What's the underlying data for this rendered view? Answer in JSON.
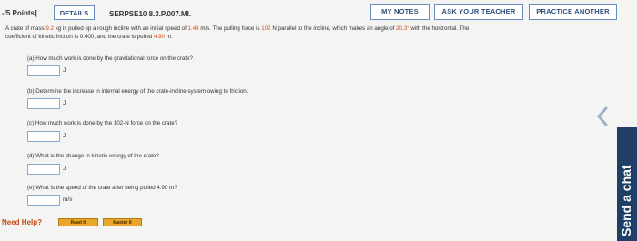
{
  "header": {
    "points": "-/5 Points]",
    "details_label": "DETAILS",
    "problem_id": "SERPSE10 8.3.P.007.MI.",
    "my_notes_label": "MY NOTES",
    "ask_teacher_label": "ASK YOUR TEACHER",
    "practice_label": "PRACTICE ANOTHER"
  },
  "problem": {
    "line1_a": "A crate of mass ",
    "mass": "9.2",
    "line1_b": " kg is pulled up a rough incline with an initial speed of ",
    "speed": "1.48",
    "line1_c": " m/s. The pulling force is ",
    "force": "102",
    "line1_d": " N parallel to the incline, which makes an angle of ",
    "angle": "20.3°",
    "line1_e": " with the horizontal. The",
    "line2_a": "coefficient of kinetic friction is 0.400, and the crate is pulled ",
    "distance": "4.90",
    "line2_b": " m."
  },
  "parts": [
    {
      "label": "(a) How much work is done by the gravitational force on the crate?",
      "unit": "J",
      "value": ""
    },
    {
      "label": "(b) Determine the increase in internal energy of the crate-incline system owing to friction.",
      "unit": "J",
      "value": ""
    },
    {
      "label": "(c) How much work is done by the 102-N force on the crate?",
      "unit": "J",
      "value": ""
    },
    {
      "label": "(d) What is the change in kinetic energy of the crate?",
      "unit": "J",
      "value": ""
    },
    {
      "label": "(e) What is the speed of the crate after being pulled 4.90 m?",
      "unit": "m/s",
      "value": ""
    }
  ],
  "help": {
    "label": "Need Help?",
    "read_it": "Read It",
    "master_it": "Master It"
  },
  "chat": {
    "label": "Send a chat"
  },
  "colors": {
    "highlight": "#d84a1b",
    "link_blue": "#2e4f7d",
    "chat_bg": "#1f3f66",
    "help_orange": "#e8a62a"
  },
  "icons": {
    "chevron": "chevron-left-icon"
  }
}
